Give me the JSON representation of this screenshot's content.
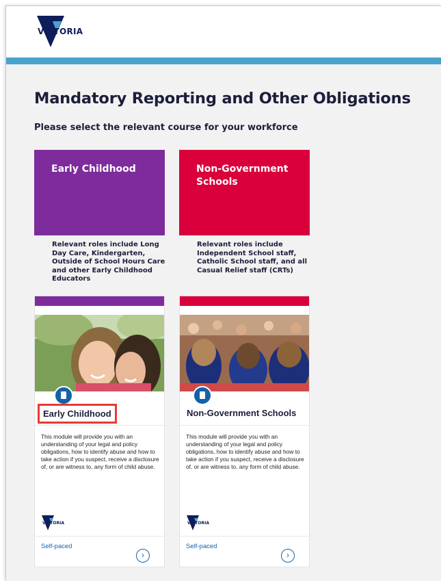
{
  "header": {
    "logo_text": "VICTORIA",
    "stripe_color": "#4aa3cf"
  },
  "page": {
    "title": "Mandatory Reporting and Other Obligations",
    "subtitle": "Please select the relevant course for your workforce"
  },
  "tiles": [
    {
      "title": "Early Childhood",
      "color": "#7e2b9c",
      "description": "Relevant roles include Long Day Care, Kindergarten, Outside of School Hours Care and other Early Childhood Educators"
    },
    {
      "title": "Non-Government Schools",
      "color": "#d9003c",
      "description": "Relevant roles include Independent School staff, Catholic School staff, and all Casual Relief staff (CRTs)"
    }
  ],
  "cards": [
    {
      "title": "Early Childhood",
      "highlighted": true,
      "description": "This module will provide you with an understanding of your legal and policy obligations, how to identify abuse and how to take action if you suspect, receive a disclosure of, or are witness to, any form of child abuse.",
      "logo_text": "VICTORIA",
      "pace": "Self-paced",
      "icon": "book-icon",
      "action_icon": "chevron-right-icon"
    },
    {
      "title": "Non-Government Schools",
      "highlighted": false,
      "description": "This module will provide you with an understanding of your legal and policy obligations, how to identify abuse and how to take action if you suspect, receive a disclosure of, or are witness to, any form of child abuse.",
      "logo_text": "VICTORIA",
      "pace": "Self-paced",
      "icon": "book-icon",
      "action_icon": "chevron-right-icon"
    }
  ]
}
